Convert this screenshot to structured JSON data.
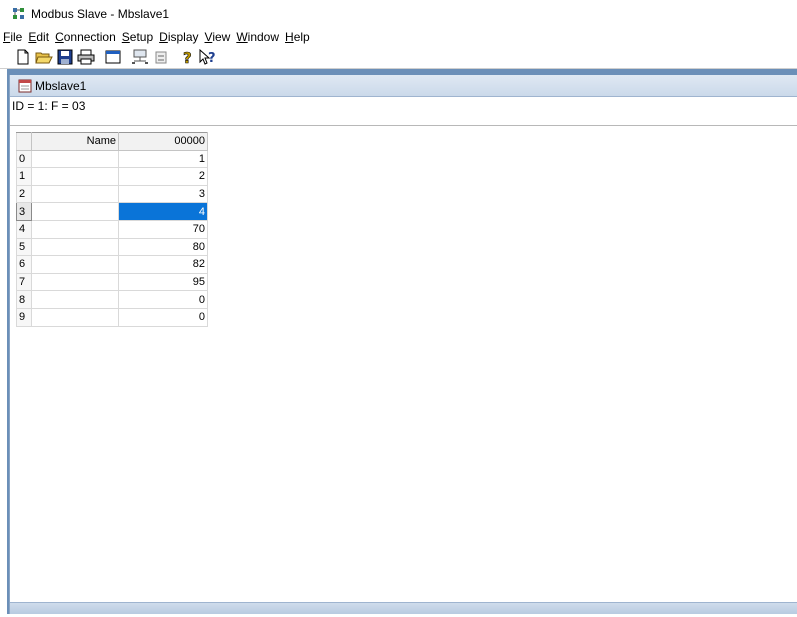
{
  "window": {
    "title": "Modbus Slave - Mbslave1",
    "icon": "modbus-app-icon"
  },
  "menu": [
    {
      "label": "File",
      "accel": "F",
      "rest": "ile"
    },
    {
      "label": "Edit",
      "accel": "E",
      "rest": "dit"
    },
    {
      "label": "Connection",
      "accel": "C",
      "rest": "onnection"
    },
    {
      "label": "Setup",
      "accel": "S",
      "rest": "etup"
    },
    {
      "label": "Display",
      "accel": "D",
      "rest": "isplay"
    },
    {
      "label": "View",
      "accel": "V",
      "rest": "iew"
    },
    {
      "label": "Window",
      "accel": "W",
      "rest": "indow"
    },
    {
      "label": "Help",
      "accel": "H",
      "rest": "elp"
    }
  ],
  "toolbar": {
    "buttons": [
      "new-icon",
      "open-icon",
      "save-icon",
      "print-icon",
      "window-icon",
      "connect-icon",
      "disconnect-icon",
      "help-icon",
      "context-help-icon"
    ]
  },
  "child": {
    "title": "Mbslave1",
    "info": "ID = 1: F = 03"
  },
  "grid": {
    "headers": {
      "name": "Name",
      "value": "00000"
    },
    "rows": [
      {
        "index": "0",
        "name": "",
        "value": "1"
      },
      {
        "index": "1",
        "name": "",
        "value": "2"
      },
      {
        "index": "2",
        "name": "",
        "value": "3"
      },
      {
        "index": "3",
        "name": "",
        "value": "4"
      },
      {
        "index": "4",
        "name": "",
        "value": "70"
      },
      {
        "index": "5",
        "name": "",
        "value": "80"
      },
      {
        "index": "6",
        "name": "",
        "value": "82"
      },
      {
        "index": "7",
        "name": "",
        "value": "95"
      },
      {
        "index": "8",
        "name": "",
        "value": "0"
      },
      {
        "index": "9",
        "name": "",
        "value": "0"
      }
    ],
    "selected_row": "3"
  },
  "colors": {
    "selection": "#0a74d8",
    "mdi_background": "#6b8fb8"
  }
}
